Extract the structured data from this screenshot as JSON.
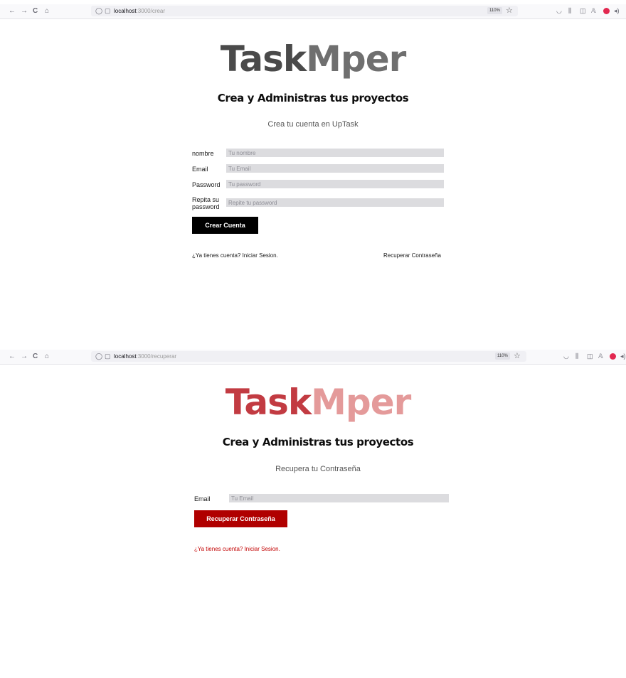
{
  "colors": {
    "logo_dark": "#4a4a4a",
    "logo_accent": "#6f6f6f",
    "button_dark": "#000000",
    "logo_red": "#c23b42",
    "logo_pink": "#e49a9a",
    "button_red": "#b00000",
    "link_red": "#c20000",
    "input_bg": "#dcdcdf"
  },
  "icons": {
    "back": "←",
    "forward": "→",
    "reload": "C",
    "home": "⌂",
    "shield": "◯",
    "page": "▢",
    "bookmark": "☆",
    "pocket": "◡",
    "library": "⫼",
    "sidebar": "◫",
    "extension": "𝔸",
    "addon": "●",
    "speaker": "◂)"
  },
  "create_page": {
    "browser": {
      "url_host": "localhost",
      "url_path": ":3000/crear",
      "zoom": "110%"
    },
    "logo_part1": "Task",
    "logo_part2": "Mper",
    "subtitle": "Crea y Administras tus proyectos",
    "description": "Crea tu cuenta en UpTask",
    "fields": [
      {
        "label": "nombre",
        "placeholder": "Tu nombre",
        "type": "text"
      },
      {
        "label": "Email",
        "placeholder": "Tu Email",
        "type": "email"
      },
      {
        "label": "Password",
        "placeholder": "Tu password",
        "type": "password"
      },
      {
        "label": "Repita su password",
        "placeholder": "Repite tu password",
        "type": "password"
      }
    ],
    "submit_label": "Crear Cuenta",
    "login_link": "¿Ya tienes cuenta? Iniciar Sesion.",
    "recover_link": "Recuperar Contraseña"
  },
  "recover_page": {
    "browser": {
      "url_host": "localhost",
      "url_path": ":3000/recuperar",
      "zoom": "110%"
    },
    "logo_part1": "Task",
    "logo_part2": "Mper",
    "subtitle": "Crea y Administras tus proyectos",
    "description": "Recupera tu Contraseña",
    "fields": [
      {
        "label": "Email",
        "placeholder": "Tu Email",
        "type": "email"
      }
    ],
    "submit_label": "Recuperar Contraseña",
    "login_link": "¿Ya tienes cuenta? Iniciar Sesion."
  }
}
